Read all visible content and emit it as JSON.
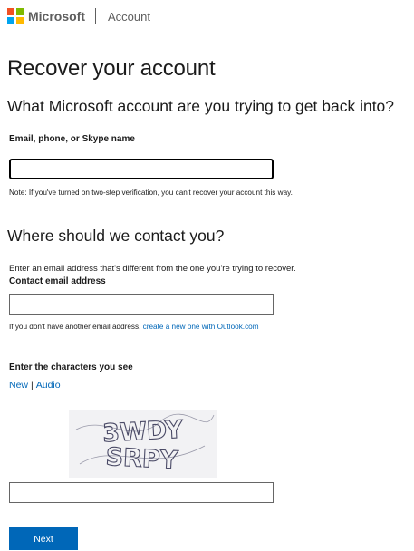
{
  "header": {
    "brand": "Microsoft",
    "section": "Account",
    "logo_colors": [
      "#f25022",
      "#7fba00",
      "#00a4ef",
      "#ffb900"
    ]
  },
  "page": {
    "title": "Recover your account",
    "account_question": "What Microsoft account are you trying to get back into?"
  },
  "account_field": {
    "label": "Email, phone, or Skype name",
    "value": "",
    "note": "Note: If you've turned on two-step verification, you can't recover your account this way."
  },
  "contact": {
    "heading": "Where should we contact you?",
    "instruction": "Enter an email address that's different from the one you're trying to recover.",
    "label": "Contact email address",
    "value": "",
    "hint_prefix": "If you don't have another email address, ",
    "hint_link": "create a new one with Outlook.com"
  },
  "captcha": {
    "label": "Enter the characters you see",
    "new_label": "New",
    "separator": "|",
    "audio_label": "Audio",
    "value": "",
    "line1": "3WDY",
    "line2": "SRPY"
  },
  "actions": {
    "next_label": "Next"
  },
  "colors": {
    "accent": "#0067b8",
    "text": "#1b1b1b",
    "muted": "#5e5e5e"
  }
}
